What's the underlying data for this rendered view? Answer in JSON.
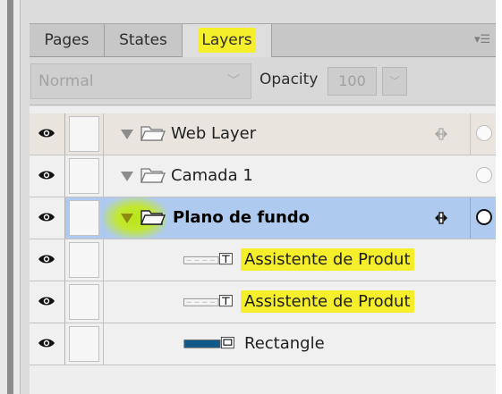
{
  "tabs": [
    {
      "label": "Pages"
    },
    {
      "label": "States"
    },
    {
      "label": "Layers",
      "highlight": "#f5ee2a"
    }
  ],
  "panel_menu_icon": "panel-menu-icon",
  "options": {
    "blend_mode": "Normal",
    "opacity_label": "Opacity",
    "opacity_value": "100"
  },
  "layers": [
    {
      "name": "Web Layer",
      "type": "folder",
      "expanded": true,
      "visible": true
    },
    {
      "name": "Camada 1",
      "type": "folder",
      "expanded": true,
      "visible": true
    },
    {
      "name": "Plano de fundo",
      "type": "folder",
      "expanded": true,
      "visible": true,
      "selected": true
    },
    {
      "name": "Assistente de Produt",
      "type": "text",
      "visible": true
    },
    {
      "name": "Assistente de Produt",
      "type": "text",
      "visible": true
    },
    {
      "name": "Rectangle",
      "type": "rectangle",
      "visible": true
    }
  ],
  "colors": {
    "highlight": "#f5ee2a",
    "selection": "#aecaee",
    "rectangle_fill": "#12598a"
  }
}
